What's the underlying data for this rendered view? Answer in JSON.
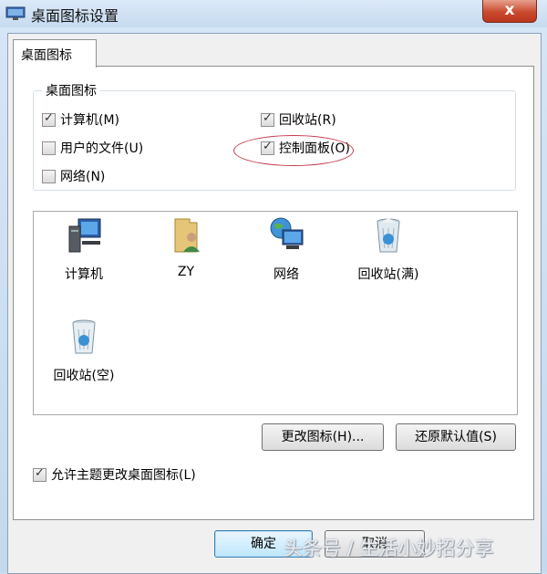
{
  "window": {
    "title": "桌面图标设置",
    "close_symbol": "x"
  },
  "tab": {
    "label": "桌面图标"
  },
  "group": {
    "title": "桌面图标",
    "checkboxes": [
      {
        "label": "计算机(M)",
        "checked": true
      },
      {
        "label": "回收站(R)",
        "checked": true
      },
      {
        "label": "用户的文件(U)",
        "checked": false
      },
      {
        "label": "控制面板(O)",
        "checked": true
      },
      {
        "label": "网络(N)",
        "checked": false
      }
    ]
  },
  "icons": [
    {
      "name": "计算机",
      "icon": "computer-icon"
    },
    {
      "name": "ZY",
      "icon": "user-folder-icon"
    },
    {
      "name": "网络",
      "icon": "network-icon"
    },
    {
      "name": "回收站(满)",
      "icon": "recycle-bin-full-icon"
    },
    {
      "name": "回收站(空)",
      "icon": "recycle-bin-empty-icon"
    }
  ],
  "buttons": {
    "change_icon": "更改图标(H)...",
    "restore_default": "还原默认值(S)",
    "ok": "确定",
    "cancel": "取消"
  },
  "theme_option": {
    "label": "允许主题更改桌面图标(L)",
    "checked": true
  },
  "watermark": "头条号 / 生活小妙招分享"
}
